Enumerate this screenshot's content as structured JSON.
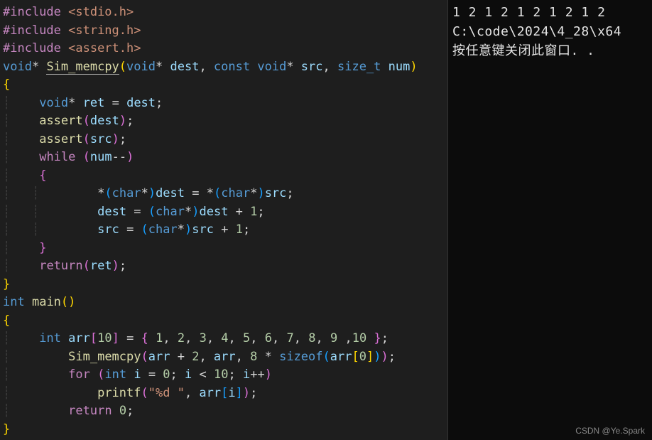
{
  "editor": {
    "lines": {
      "l1_pre": "#include",
      "l1_inc": " <stdio.h>",
      "l2_pre": "#include",
      "l2_inc": " <string.h>",
      "l3_pre": "#include",
      "l3_inc": " <assert.h>",
      "l4_void1": "void",
      "l4_star1": "* ",
      "l4_fn": "Sim_memcpy",
      "l4_p1": "(",
      "l4_void2": "void",
      "l4_star2": "* ",
      "l4_dest": "dest",
      "l4_comma1": ", ",
      "l4_const": "const",
      "l4_sp1": " ",
      "l4_void3": "void",
      "l4_star3": "* ",
      "l4_src": "src",
      "l4_comma2": ", ",
      "l4_sizet": "size_t",
      "l4_sp2": " ",
      "l4_num": "num",
      "l4_p2": ")",
      "l5": "{",
      "l6_ind": "    ",
      "l6_void": "void",
      "l6_star": "* ",
      "l6_ret": "ret",
      "l6_eq": " = ",
      "l6_dest": "dest",
      "l6_semi": ";",
      "l7_ind": "    ",
      "l7_fn": "assert",
      "l7_p1": "(",
      "l7_dest": "dest",
      "l7_p2": ")",
      "l7_semi": ";",
      "l8_ind": "    ",
      "l8_fn": "assert",
      "l8_p1": "(",
      "l8_src": "src",
      "l8_p2": ")",
      "l8_semi": ";",
      "l9_ind": "    ",
      "l9_while": "while",
      "l9_sp": " ",
      "l9_p1": "(",
      "l9_num": "num",
      "l9_dec": "--",
      "l9_p2": ")",
      "l10_ind": "    ",
      "l10_brace": "{",
      "l11_ind": "        ",
      "l11_star1": "*",
      "l11_p1": "(",
      "l11_char1": "char",
      "l11_star2": "*",
      "l11_p2": ")",
      "l11_dest1": "dest",
      "l11_eq": " = ",
      "l11_star3": "*",
      "l11_p3": "(",
      "l11_char2": "char",
      "l11_star4": "*",
      "l11_p4": ")",
      "l11_src": "src",
      "l11_semi": ";",
      "l12_ind": "        ",
      "l12_dest1": "dest",
      "l12_eq": " = ",
      "l12_p1": "(",
      "l12_char": "char",
      "l12_star": "*",
      "l12_p2": ")",
      "l12_dest2": "dest",
      "l12_plus": " + ",
      "l12_one": "1",
      "l12_semi": ";",
      "l13_ind": "        ",
      "l13_src1": "src",
      "l13_eq": " = ",
      "l13_p1": "(",
      "l13_char": "char",
      "l13_star": "*",
      "l13_p2": ")",
      "l13_src2": "src",
      "l13_plus": " + ",
      "l13_one": "1",
      "l13_semi": ";",
      "l14_ind": "    ",
      "l14_brace": "}",
      "l15_ind": "    ",
      "l15_return": "return",
      "l15_p1": "(",
      "l15_ret": "ret",
      "l15_p2": ")",
      "l15_semi": ";",
      "l16": "}",
      "l17_int": "int",
      "l17_sp": " ",
      "l17_fn": "main",
      "l17_p1": "(",
      "l17_p2": ")",
      "l18": "{",
      "l19_ind": "    ",
      "l19_int": "int",
      "l19_sp": " ",
      "l19_arr": "arr",
      "l19_b1": "[",
      "l19_ten": "10",
      "l19_b2": "]",
      "l19_eq": " = ",
      "l19_brace1": "{",
      "l19_sp2": " ",
      "l19_n1": "1",
      "l19_c1": ", ",
      "l19_n2": "2",
      "l19_c2": ", ",
      "l19_n3": "3",
      "l19_c3": ", ",
      "l19_n4": "4",
      "l19_c4": ", ",
      "l19_n5": "5",
      "l19_c5": ", ",
      "l19_n6": "6",
      "l19_c6": ", ",
      "l19_n7": "7",
      "l19_c7": ", ",
      "l19_n8": "8",
      "l19_c8": ", ",
      "l19_n9": "9",
      "l19_c9": " ,",
      "l19_n10": "10",
      "l19_sp3": " ",
      "l19_brace2": "}",
      "l19_semi": ";",
      "l20_ind": "        ",
      "l20_fn": "Sim_memcpy",
      "l20_p1": "(",
      "l20_arr1": "arr",
      "l20_plus1": " + ",
      "l20_two": "2",
      "l20_c1": ", ",
      "l20_arr2": "arr",
      "l20_c2": ", ",
      "l20_eight": "8",
      "l20_mul": " * ",
      "l20_sizeof": "sizeof",
      "l20_p2": "(",
      "l20_arr3": "arr",
      "l20_b1": "[",
      "l20_zero": "0",
      "l20_b2": "]",
      "l20_p3": ")",
      "l20_p4": ")",
      "l20_semi": ";",
      "l21_ind": "        ",
      "l21_for": "for",
      "l21_sp": " ",
      "l21_p1": "(",
      "l21_int": "int",
      "l21_sp2": " ",
      "l21_i1": "i",
      "l21_eq": " = ",
      "l21_zero": "0",
      "l21_semi1": "; ",
      "l21_i2": "i",
      "l21_lt": " < ",
      "l21_ten": "10",
      "l21_semi2": "; ",
      "l21_i3": "i",
      "l21_inc": "++",
      "l21_p2": ")",
      "l22_ind": "            ",
      "l22_fn": "printf",
      "l22_p1": "(",
      "l22_str": "\"%d \"",
      "l22_c": ", ",
      "l22_arr": "arr",
      "l22_b1": "[",
      "l22_i": "i",
      "l22_b2": "]",
      "l22_p2": ")",
      "l22_semi": ";",
      "l23_ind": "        ",
      "l23_return": "return",
      "l23_sp": " ",
      "l23_zero": "0",
      "l23_semi": ";",
      "l24": "}"
    }
  },
  "terminal": {
    "line1": "1 2 1 2 1 2 1 2 1 2",
    "line2": "C:\\code\\2024\\4_28\\x64",
    "line3": "按任意键关闭此窗口. ."
  },
  "watermark": "CSDN @Ye.Spark"
}
